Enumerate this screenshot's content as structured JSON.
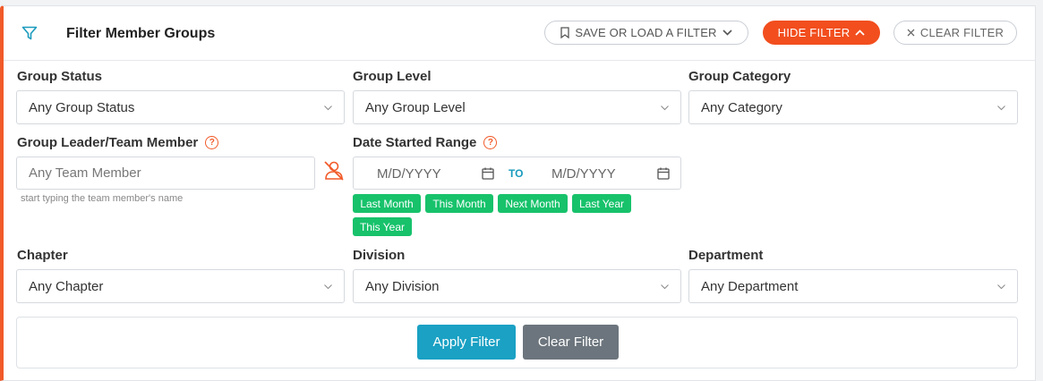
{
  "header": {
    "title": "Filter Member Groups",
    "save_label": "SAVE OR LOAD A FILTER",
    "hide_label": "HIDE FILTER",
    "clear_label": "CLEAR FILTER"
  },
  "fields": {
    "group_status": {
      "label": "Group Status",
      "value": "Any Group Status"
    },
    "group_level": {
      "label": "Group Level",
      "value": "Any Group Level"
    },
    "group_category": {
      "label": "Group Category",
      "value": "Any Category"
    },
    "leader": {
      "label": "Group Leader/Team Member",
      "placeholder": "Any Team Member",
      "hint": "start typing the team member's name"
    },
    "date_range": {
      "label": "Date Started Range",
      "from_placeholder": "M/D/YYYY",
      "to_label": "TO",
      "to_placeholder": "M/D/YYYY"
    },
    "chapter": {
      "label": "Chapter",
      "value": "Any Chapter"
    },
    "division": {
      "label": "Division",
      "value": "Any Division"
    },
    "department": {
      "label": "Department",
      "value": "Any Department"
    }
  },
  "quick_dates": [
    "Last Month",
    "This Month",
    "Next Month",
    "Last Year",
    "This Year"
  ],
  "actions": {
    "apply_label": "Apply Filter",
    "clear_label": "Clear Filter"
  },
  "colors": {
    "accent": "#f15a29",
    "hide_button": "#f24e1e",
    "chip": "#17c26b",
    "apply": "#1aa1c4",
    "clear": "#6c757d",
    "filter_icon": "#1a9bbd"
  },
  "icons": {
    "filter": "filter-icon",
    "bookmark": "bookmark-icon",
    "chevron": "chevron-down-icon",
    "chevron_up": "chevron-up-icon",
    "close": "close-icon",
    "help": "help-icon",
    "calendar": "calendar-icon",
    "remove_user": "remove-user-icon"
  }
}
